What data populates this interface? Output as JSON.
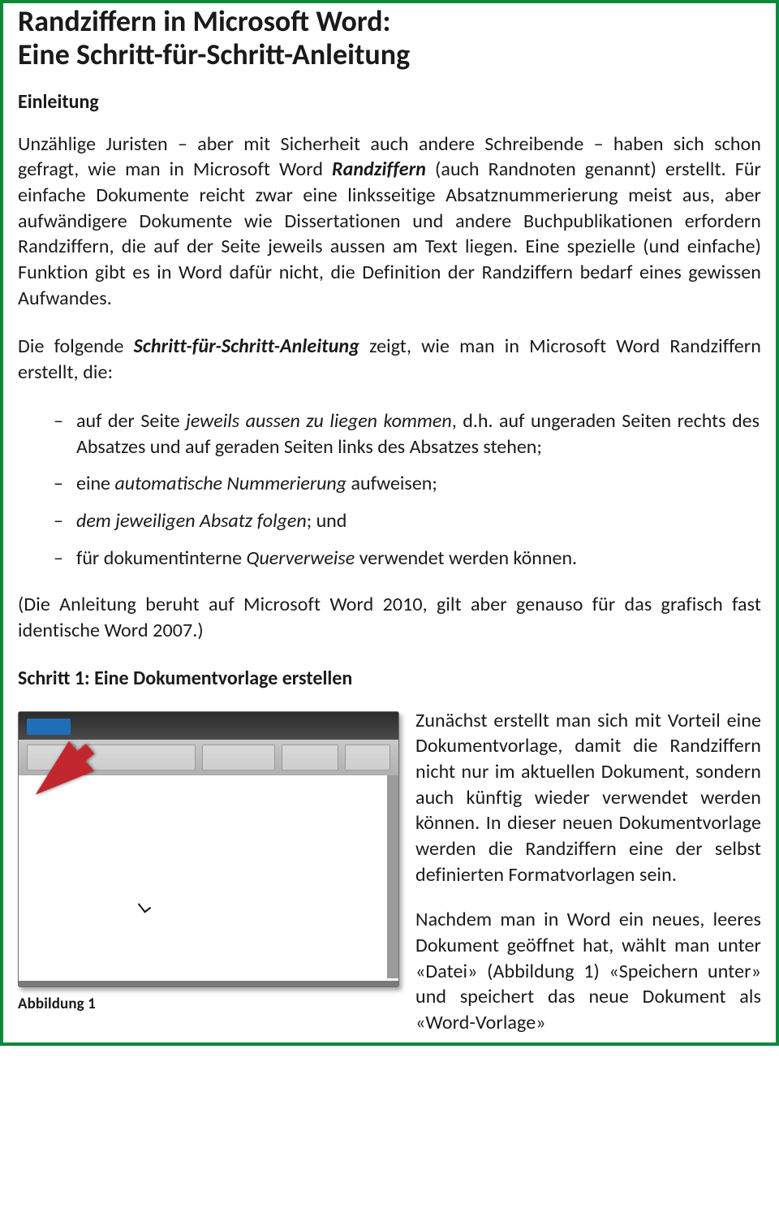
{
  "title_line1": "Randziffern in Microsoft Word:",
  "title_line2": "Eine Schritt-für-Schritt-Anleitung",
  "heading_intro": "Einleitung",
  "intro": {
    "pre": "Unzählige Juristen – aber mit Sicherheit auch andere Schreibende – haben sich schon gefragt, wie man in Microsoft Word ",
    "kw": "Randziffern",
    "post": " (auch Randnoten genannt) erstellt. Für einfache Dokumente reicht zwar eine linksseitige Absatznummerierung meist aus, aber aufwändigere Dokumente wie Dissertationen und andere Buchpublikationen erfordern Randziffern, die auf der Seite jeweils aussen am Text liegen. Eine spezielle (und einfache) Funktion gibt es in Word dafür nicht, die Definition der Randziffern bedarf eines gewissen Aufwandes."
  },
  "lead": {
    "pre": "Die folgende ",
    "kw": "Schritt-für-Schritt-Anleitung",
    "post": " zeigt, wie man in Microsoft Word Randziffern erstellt, die:"
  },
  "bullets": {
    "b1_pre": "auf der Seite ",
    "b1_it": "jeweils aussen zu liegen kommen",
    "b1_post": ", d.h. auf ungeraden Seiten rechts des Absatzes und auf geraden Seiten links des Absatzes stehen;",
    "b2_pre": "eine ",
    "b2_it": "automatische Nummerierung",
    "b2_post": " aufweisen;",
    "b3_it": "dem jeweiligen Absatz folgen",
    "b3_post": "; und",
    "b4_pre": "für dokumentinterne ",
    "b4_it": "Querverweise",
    "b4_post": " verwendet werden können."
  },
  "note": "(Die Anleitung beruht auf Microsoft Word 2010, gilt aber genauso für das grafisch fast identische Word 2007.)",
  "heading_s1": "Schritt 1: Eine Dokumentvorlage erstellen",
  "s1_text": "Zunächst erstellt man sich mit Vorteil eine Dokumentvorlage, damit die Randziffern nicht nur im aktuellen Dokument, sondern auch künftig wieder verwendet werden können. In dieser neuen Dokumentvorlage werden die Randziffern eine der selbst definierten Formatvorlagen sein.",
  "s1_text2": "Nachdem man in Word ein neues, leeres Dokument geöffnet hat, wählt man unter «Datei» (Abbildung 1) «Speichern unter» und speichert das neue Dokument als «Word-Vorlage»",
  "figure_caption": "Abbildung 1"
}
